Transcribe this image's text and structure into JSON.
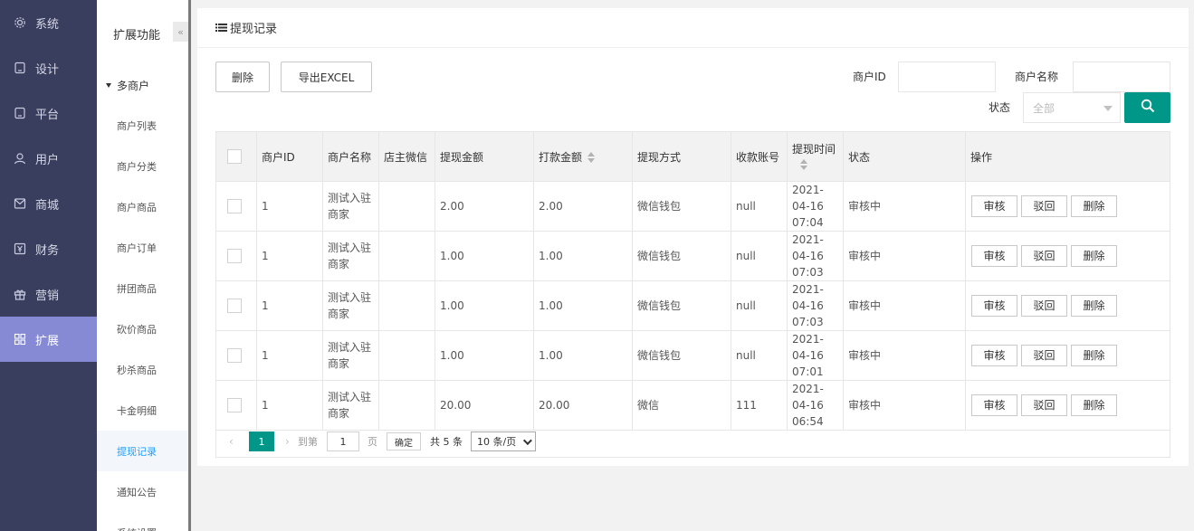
{
  "sidebar": {
    "items": [
      {
        "label": "系统",
        "icon": "gear-icon"
      },
      {
        "label": "设计",
        "icon": "tablet-icon"
      },
      {
        "label": "平台",
        "icon": "tablet-icon"
      },
      {
        "label": "用户",
        "icon": "user-icon"
      },
      {
        "label": "商城",
        "icon": "mail-icon"
      },
      {
        "label": "财务",
        "icon": "yen-icon"
      },
      {
        "label": "营销",
        "icon": "gift-icon"
      },
      {
        "label": "扩展",
        "icon": "grid-icon",
        "active": true
      }
    ]
  },
  "subnav": {
    "title": "扩展功能",
    "collapse_glyph": "«",
    "group": "多商户",
    "items": [
      "商户列表",
      "商户分类",
      "商户商品",
      "商户订单",
      "拼团商品",
      "砍价商品",
      "秒杀商品",
      "卡金明细",
      "提现记录",
      "通知公告",
      "系统设置"
    ],
    "active_index": 8
  },
  "page": {
    "title": "提现记录",
    "delete_btn": "删除",
    "export_btn": "导出EXCEL",
    "filters": {
      "merchant_id_label": "商户ID",
      "merchant_name_label": "商户名称",
      "status_label": "状态",
      "status_value": "全部"
    }
  },
  "table": {
    "headers": [
      "商户ID",
      "商户名称",
      "店主微信",
      "提现金额",
      "打款金额",
      "提现方式",
      "收款账号",
      "提现时间",
      "状态",
      "操作"
    ],
    "rows": [
      {
        "id": "1",
        "name": "测试入驻商家",
        "wechat": "",
        "amount": "2.00",
        "paid": "2.00",
        "method": "微信钱包",
        "account": "null",
        "time": "2021-04-16 07:04",
        "status": "审核中"
      },
      {
        "id": "1",
        "name": "测试入驻商家",
        "wechat": "",
        "amount": "1.00",
        "paid": "1.00",
        "method": "微信钱包",
        "account": "null",
        "time": "2021-04-16 07:03",
        "status": "审核中"
      },
      {
        "id": "1",
        "name": "测试入驻商家",
        "wechat": "",
        "amount": "1.00",
        "paid": "1.00",
        "method": "微信钱包",
        "account": "null",
        "time": "2021-04-16 07:03",
        "status": "审核中"
      },
      {
        "id": "1",
        "name": "测试入驻商家",
        "wechat": "",
        "amount": "1.00",
        "paid": "1.00",
        "method": "微信钱包",
        "account": "null",
        "time": "2021-04-16 07:01",
        "status": "审核中"
      },
      {
        "id": "1",
        "name": "测试入驻商家",
        "wechat": "",
        "amount": "20.00",
        "paid": "20.00",
        "method": "微信",
        "account": "111",
        "time": "2021-04-16 06:54",
        "status": "审核中"
      }
    ],
    "actions": [
      "审核",
      "驳回",
      "删除"
    ]
  },
  "pager": {
    "current": "1",
    "goto_prefix": "到第",
    "goto_value": "1",
    "goto_suffix": "页",
    "ok": "确定",
    "total": "共 5 条",
    "page_size": "10 条/页"
  },
  "colors": {
    "sidebar": "#393d5e",
    "active": "#8689d4",
    "primary": "#009688",
    "link": "#1e9fff"
  }
}
